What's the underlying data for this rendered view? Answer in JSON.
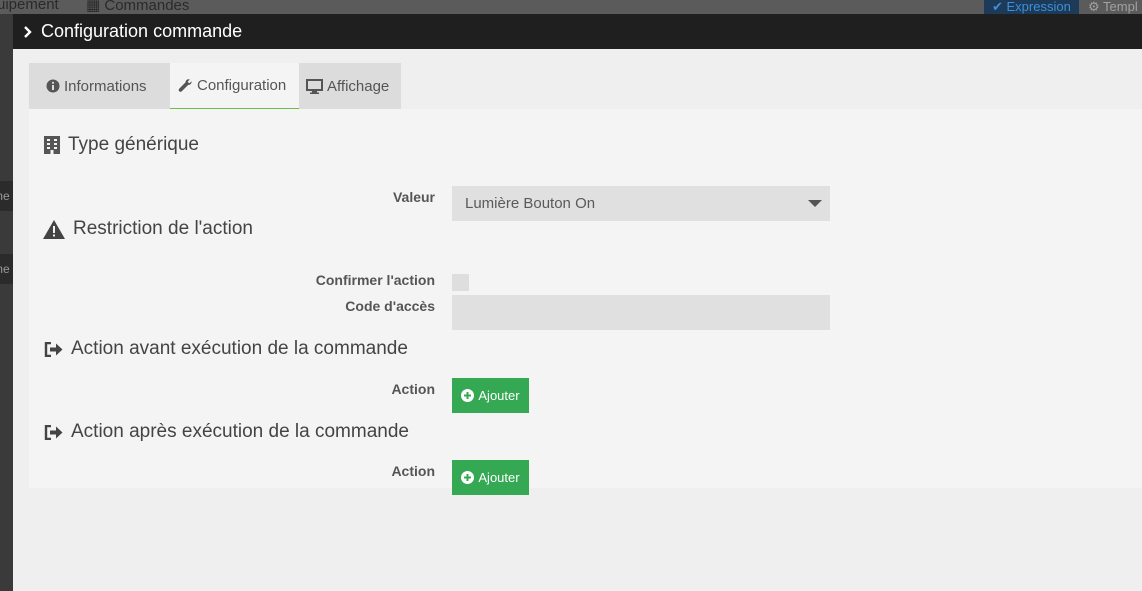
{
  "background": {
    "top_left_text": "uipement",
    "top_tab_text": "Commandes",
    "expression_button": "Expression",
    "template_button": "Templ",
    "side_tab_1": "me",
    "side_tab_2": "me"
  },
  "modal": {
    "title": "Configuration commande",
    "tabs": [
      {
        "label": "Informations",
        "icon": "info-circle-icon",
        "active": false
      },
      {
        "label": "Configuration",
        "icon": "wrench-icon",
        "active": true
      },
      {
        "label": "Affichage",
        "icon": "desktop-icon",
        "active": false
      }
    ]
  },
  "generic_type": {
    "title": "Type générique",
    "icon": "building-icon",
    "value_label": "Valeur",
    "value_selected": "Lumière Bouton On"
  },
  "restriction": {
    "title": "Restriction de l'action",
    "icon": "warning-icon",
    "confirm_label": "Confirmer l'action",
    "confirm_checked": false,
    "access_code_label": "Code d'accès",
    "access_code_value": ""
  },
  "pre_action": {
    "title": "Action avant exécution de la commande",
    "icon": "sign-out-icon",
    "action_label": "Action",
    "add_button": "Ajouter"
  },
  "post_action": {
    "title": "Action après exécution de la commande",
    "icon": "sign-out-icon",
    "action_label": "Action",
    "add_button": "Ajouter"
  },
  "colors": {
    "header_bg": "#1f1f1f",
    "modal_bg": "#efefef",
    "add_button_bg": "#35a853",
    "active_tab_underline": "#6abf4b"
  }
}
